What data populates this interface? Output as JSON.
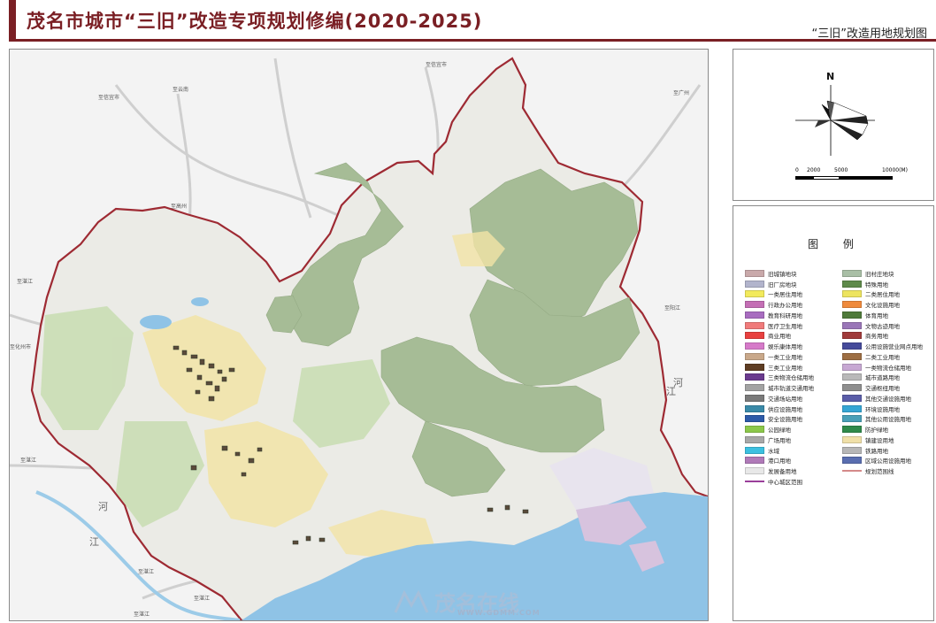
{
  "header": {
    "title": "茂名市城市“三旧”改造专项规划修编(2020-2025)",
    "subtitle": "“三旧”改造用地规划图",
    "accent_color": "#7a1f24"
  },
  "compass": {
    "north": "N",
    "scale_ticks": [
      "0",
      "2000",
      "5000",
      "10000(M)"
    ]
  },
  "legend": {
    "title": "图 例",
    "items": [
      {
        "label": "旧城镇地块",
        "color": "#c9a9aa",
        "kind": "fill"
      },
      {
        "label": "旧村庄地块",
        "color": "#a9bfa6",
        "kind": "fill"
      },
      {
        "label": "旧厂房地块",
        "color": "#b2b4cc",
        "kind": "fill"
      },
      {
        "label": "特殊用地",
        "color": "#5e8a4a",
        "kind": "fill"
      },
      {
        "label": "一类居住用地",
        "color": "#f2ea5c",
        "kind": "fill"
      },
      {
        "label": "二类居住用地",
        "color": "#ede45f",
        "kind": "fill"
      },
      {
        "label": "行政办公用地",
        "color": "#c46fb5",
        "kind": "fill"
      },
      {
        "label": "文化设施用地",
        "color": "#ef8a3c",
        "kind": "fill"
      },
      {
        "label": "教育科研用地",
        "color": "#a86cc0",
        "kind": "fill"
      },
      {
        "label": "体育用地",
        "color": "#4f7a3a",
        "kind": "fill"
      },
      {
        "label": "医疗卫生用地",
        "color": "#f07b7b",
        "kind": "fill"
      },
      {
        "label": "文物古迹用地",
        "color": "#9a76b8",
        "kind": "fill"
      },
      {
        "label": "商业用地",
        "color": "#e8403f",
        "kind": "fill"
      },
      {
        "label": "商务用地",
        "color": "#a03a3a",
        "kind": "fill"
      },
      {
        "label": "娱乐康体用地",
        "color": "#d67ac9",
        "kind": "fill"
      },
      {
        "label": "公用设施营业网点用地",
        "color": "#454a9a",
        "kind": "fill"
      },
      {
        "label": "一类工业用地",
        "color": "#c9a88a",
        "kind": "fill"
      },
      {
        "label": "二类工业用地",
        "color": "#9d6e43",
        "kind": "fill"
      },
      {
        "label": "三类工业用地",
        "color": "#5e3d23",
        "kind": "fill"
      },
      {
        "label": "一类物流仓储用地",
        "color": "#c7a8d3",
        "kind": "fill"
      },
      {
        "label": "三类物流仓储用地",
        "color": "#6a3a8e",
        "kind": "fill"
      },
      {
        "label": "城市道路用地",
        "color": "#b9b9b9",
        "kind": "fill"
      },
      {
        "label": "城市轨道交通用地",
        "color": "#a3a3a3",
        "kind": "fill"
      },
      {
        "label": "交通枢纽用地",
        "color": "#8f8f8f",
        "kind": "fill"
      },
      {
        "label": "交通场站用地",
        "color": "#7a7a7a",
        "kind": "fill"
      },
      {
        "label": "其他交通设施用地",
        "color": "#5a5da8",
        "kind": "fill"
      },
      {
        "label": "供应设施用地",
        "color": "#3a8aa8",
        "kind": "fill"
      },
      {
        "label": "环境设施用地",
        "color": "#36a6d4",
        "kind": "fill"
      },
      {
        "label": "安全设施用地",
        "color": "#2d5aa8",
        "kind": "fill"
      },
      {
        "label": "其他公用设施用地",
        "color": "#4aa0b8",
        "kind": "fill"
      },
      {
        "label": "公园绿地",
        "color": "#8cc84a",
        "kind": "fill"
      },
      {
        "label": "防护绿地",
        "color": "#2f8a4a",
        "kind": "fill"
      },
      {
        "label": "广场用地",
        "color": "#a8a8a8",
        "kind": "fill"
      },
      {
        "label": "镇建设用地",
        "color": "#f0e0a8",
        "kind": "fill"
      },
      {
        "label": "水域",
        "color": "#3cc0e0",
        "kind": "fill"
      },
      {
        "label": "铁路用地",
        "color": "#b7b7b7",
        "kind": "fill"
      },
      {
        "label": "港口用地",
        "color": "#b07ab8",
        "kind": "fill"
      },
      {
        "label": "区域公用设施用地",
        "color": "#5a6eb0",
        "kind": "fill"
      },
      {
        "label": "发展备用地",
        "color": "#e8e8e8",
        "kind": "fill"
      },
      {
        "label": "规划范围线",
        "color": "#d48a8a",
        "kind": "line"
      },
      {
        "label": "中心城区范围",
        "color": "#9a3f9a",
        "kind": "line"
      }
    ]
  },
  "map": {
    "place_labels": [
      {
        "text": "至信宜市",
        "pos": [
          470,
          13
        ]
      },
      {
        "text": "至广州",
        "pos": [
          750,
          45
        ]
      },
      {
        "text": "至信宜市",
        "pos": [
          100,
          50
        ]
      },
      {
        "text": "至云南",
        "pos": [
          184,
          41
        ]
      },
      {
        "text": "至高州",
        "pos": [
          182,
          173
        ]
      },
      {
        "text": "至阳江",
        "pos": [
          740,
          288
        ]
      },
      {
        "text": "至湛江",
        "pos": [
          12,
          460
        ]
      },
      {
        "text": "至湛江",
        "pos": [
          8,
          258
        ]
      },
      {
        "text": "至化州市",
        "pos": [
          0,
          332
        ]
      },
      {
        "text": "至湛江",
        "pos": [
          145,
          586
        ]
      },
      {
        "text": "至湛江",
        "pos": [
          208,
          616
        ]
      },
      {
        "text": "至湛江",
        "pos": [
          140,
          634
        ]
      }
    ],
    "river_labels": [
      {
        "text": "江",
        "pos": [
          90,
          560
        ]
      },
      {
        "text": "河",
        "pos": [
          100,
          520
        ]
      },
      {
        "text": "江",
        "pos": [
          742,
          390
        ]
      },
      {
        "text": "河",
        "pos": [
          750,
          380
        ]
      }
    ],
    "colors": {
      "boundary": "#9e2a33",
      "forest": "#a6bc96",
      "sea": "#8fc3e6",
      "urban": "#f2e4a6",
      "land": "#ededed",
      "road": "#c7c7c7"
    }
  },
  "watermark": {
    "text": "茂名在线",
    "url": "WWW.GDMM.COM"
  }
}
